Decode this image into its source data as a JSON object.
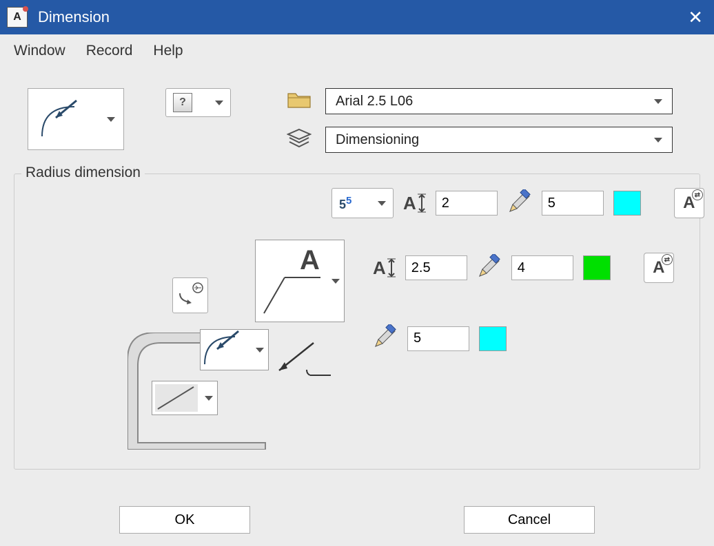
{
  "title": "Dimension",
  "menu": {
    "window": "Window",
    "record": "Record",
    "help": "Help"
  },
  "help_symbol": "?",
  "font_combo": "Arial 2.5 L06",
  "layer_combo": "Dimensioning",
  "fieldset_title": "Radius dimension",
  "row1": {
    "exponent_base": "5",
    "exponent_sup": "5",
    "height": "2",
    "pen": "5",
    "color": "#00FFFF"
  },
  "row2": {
    "height": "2.5",
    "pen": "4",
    "color": "#00E000"
  },
  "row3": {
    "pen": "5",
    "color": "#00FFFF"
  },
  "buttons": {
    "ok": "OK",
    "cancel": "Cancel"
  }
}
